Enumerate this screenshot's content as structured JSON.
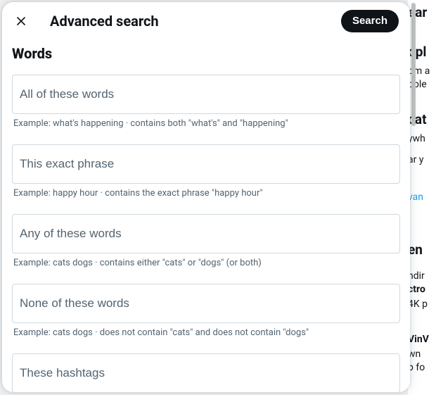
{
  "modal": {
    "title": "Advanced search",
    "search_button": "Search",
    "section_words": "Words",
    "fields": {
      "all_words": {
        "placeholder": "All of these words",
        "hint": "Example: what's happening · contains both \"what's\" and \"happening\""
      },
      "exact_phrase": {
        "placeholder": "This exact phrase",
        "hint": "Example: happy hour · contains the exact phrase \"happy hour\""
      },
      "any_words": {
        "placeholder": "Any of these words",
        "hint": "Example: cats dogs · contains either \"cats\" or \"dogs\" (or both)"
      },
      "none_words": {
        "placeholder": "None of these words",
        "hint": "Example: cats dogs · does not contain \"cats\" and does not contain \"dogs\""
      },
      "hashtags": {
        "placeholder": "These hashtags",
        "hint": ""
      }
    }
  },
  "bg": {
    "f1": "ear",
    "f2": "opl",
    "f3": "om a",
    "f4": "ople",
    "f5": "cat",
    "f6": "ywh",
    "f7": "ar y",
    "f8": "van",
    "f9": "en",
    "f10": "ndir",
    "f11": "ctro",
    "f12": "4K p",
    "f13": "VinV",
    "f14": "wn",
    "f15": "p fo"
  }
}
